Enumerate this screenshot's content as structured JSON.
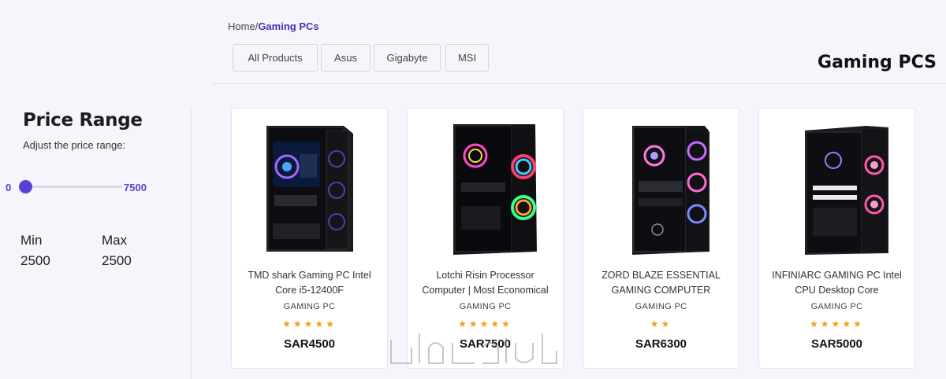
{
  "sidebar": {
    "title": "Price Range",
    "subtitle": "Adjust the price range:",
    "range_min": "0",
    "range_max": "7500",
    "slider_value": 0,
    "min_label": "Min",
    "max_label": "Max",
    "min_value": "2500",
    "max_value": "2500"
  },
  "breadcrumb": {
    "home": "Home",
    "separator": "/",
    "current": "Gaming PCs"
  },
  "filters": [
    "All Products",
    "Asus",
    "Gigabyte",
    "MSI"
  ],
  "page_title": "Gaming PCS",
  "products": [
    {
      "name": "TMD shark Gaming PC Intel Core i5-12400F",
      "category": "GAMING PC",
      "stars": "★★★★★",
      "price": "SAR4500",
      "image": "pc-case-black-tower"
    },
    {
      "name": "Lotchi Risin Processor Computer | Most Economical",
      "category": "GAMING PC",
      "stars": "★★★★★",
      "price": "SAR7500",
      "image": "pc-case-rgb-fans"
    },
    {
      "name": "ZORD BLAZE ESSENTIAL GAMING COMPUTER",
      "category": "GAMING PC",
      "stars": "★★",
      "price": "SAR6300",
      "image": "pc-case-zord-rgb"
    },
    {
      "name": "INFINIARC GAMING PC Intel CPU Desktop Core",
      "category": "GAMING PC",
      "stars": "★★★★★",
      "price": "SAR5000",
      "image": "pc-case-infiniarc"
    }
  ],
  "colors": {
    "accent": "#5b3fd6",
    "star": "#f2a01a",
    "background": "#f6f5fb"
  }
}
